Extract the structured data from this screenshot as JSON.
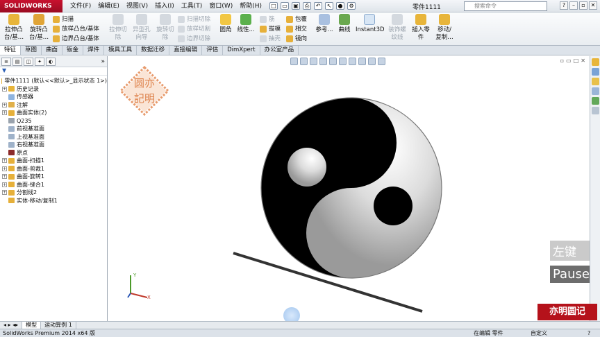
{
  "app": {
    "logo": "SOLIDWORKS",
    "document_title": "零件1111"
  },
  "menu": [
    "文件(F)",
    "编辑(E)",
    "视图(V)",
    "插入(I)",
    "工具(T)",
    "窗口(W)",
    "帮助(H)"
  ],
  "search": {
    "placeholder": "搜索命令"
  },
  "ribbon": {
    "extrude_boss": "拉伸凸\n台/基…",
    "revolve_boss": "旋转凸\n台/基…",
    "sweep": "扫描",
    "loft_boss": "放样凸台/基体",
    "boundary_boss": "边界凸台/基体",
    "extrude_cut": "拉伸切\n除",
    "hole_wizard": "异型孔\n向导",
    "revolve_cut": "旋转切\n除",
    "sweep_cut": "扫描切除",
    "loft_cut": "放样切割",
    "boundary_cut": "边界切除",
    "fillet": "圆角",
    "linear_pattern": "线性...",
    "rib": "筋",
    "draft": "拔模",
    "shell": "抽壳",
    "wrap": "包覆",
    "intersect": "相交",
    "mirror": "镜向",
    "reference": "参考...",
    "curves": "曲线",
    "instant3d": "Instant3D",
    "cosmetic_thread": "装饰螺\n纹线",
    "insert_part": "插入零\n件",
    "move_copy": "移动/\n复制…"
  },
  "tabs": [
    "特征",
    "草图",
    "曲面",
    "钣金",
    "焊件",
    "模具工具",
    "数据迁移",
    "直接编辑",
    "评估",
    "DimXpert",
    "办公室产品"
  ],
  "active_tab": "特征",
  "tree": {
    "root": "零件1111  (默认<<默认>_显示状态 1>)",
    "items": [
      {
        "label": "历史记录",
        "expand": "+"
      },
      {
        "label": "传感器",
        "expand": ""
      },
      {
        "label": "注解",
        "expand": "+"
      },
      {
        "label": "曲面实体(2)",
        "expand": "+"
      },
      {
        "label": "Q235",
        "expand": ""
      },
      {
        "label": "前视基准面",
        "expand": ""
      },
      {
        "label": "上视基准面",
        "expand": ""
      },
      {
        "label": "右视基准面",
        "expand": ""
      },
      {
        "label": "原点",
        "expand": ""
      },
      {
        "label": "曲面-扫描1",
        "expand": "+"
      },
      {
        "label": "曲面-剪裁1",
        "expand": "+"
      },
      {
        "label": "曲面-旋转1",
        "expand": "+"
      },
      {
        "label": "曲面-缝合1",
        "expand": "+"
      },
      {
        "label": "分割线2",
        "expand": "+"
      },
      {
        "label": "实体-移动/复制1",
        "expand": ""
      }
    ]
  },
  "watermark": {
    "line1": "圆亦",
    "line2": "記明"
  },
  "overlay": {
    "hint1": "左键",
    "hint2": "Pause"
  },
  "brand_stamp": "亦明圆记",
  "bottom_tabs": [
    "模型",
    "运动算例 1"
  ],
  "status": {
    "product": "SolidWorks Premium 2014 x64 版",
    "editing": "在编辑 零件",
    "custom": "自定义"
  },
  "colors": {
    "brand_red": "#c8102e",
    "accent_blue": "#3b6fb6",
    "stamp_orange": "#e07a3c"
  }
}
